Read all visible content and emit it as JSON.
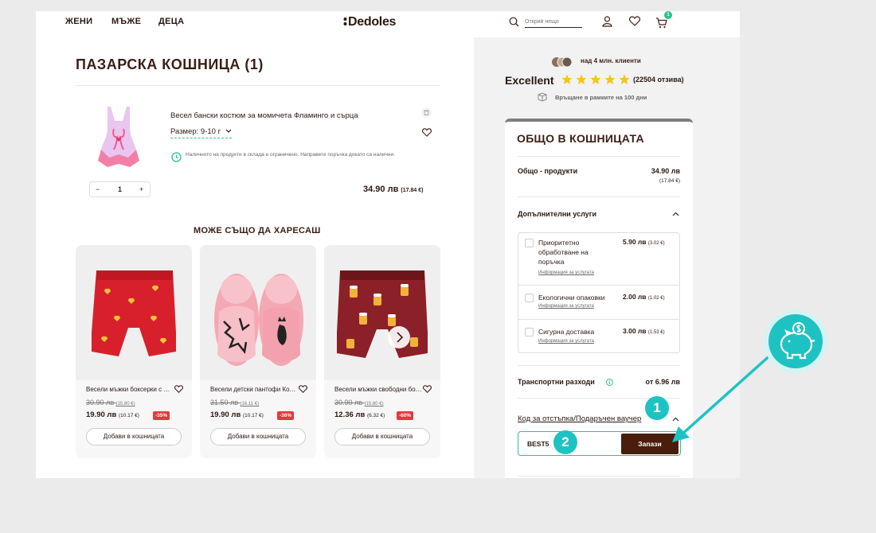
{
  "header": {
    "nav": [
      "ЖЕНИ",
      "МЪЖЕ",
      "ДЕЦА"
    ],
    "logo": "Dedoles",
    "search_placeholder": "Открий нещо",
    "cart_count": "1"
  },
  "cart": {
    "title": "ПАЗАРСКА КОШНИЦА (1)",
    "item": {
      "name": "Весел бански костюм за момичета Фламинго и сърца",
      "size": "Размер: 9-10 г",
      "stock_note": "Наличното на продукти в склада е ограничено. Направете поръчка докато са налични.",
      "qty_minus": "−",
      "qty": "1",
      "qty_plus": "+",
      "price": "34.90 лв",
      "price_eur": "(17.84 €)"
    }
  },
  "recommend": {
    "title": "МОЖЕ СЪЩО ДА ХАРЕСАШ",
    "add_label": "Добави в кошницата",
    "products": [
      {
        "name": "Весели мъжки боксерки с Valentine",
        "old": "30.90 лв",
        "old_eur": "(15.80 €)",
        "new": "19.90 лв",
        "new_eur": "(10.17 €)",
        "discount": "-35%"
      },
      {
        "name": "Весели детски пантофи Котки",
        "old": "31.50 лв",
        "old_eur": "(16.11 €)",
        "new": "19.90 лв",
        "new_eur": "(10.17 €)",
        "discount": "-36%"
      },
      {
        "name": "Весели мъжки свободни боксерки Бира",
        "old": "30.90 лв",
        "old_eur": "(15.80 €)",
        "new": "12.36 лв",
        "new_eur": "(6.32 €)",
        "discount": "-60%"
      }
    ]
  },
  "trust": {
    "clients": "над 4 млн. клиенти",
    "rating_word": "Excellent",
    "rating": 5,
    "reviews": "(22504 отзива)",
    "returns": "Връщане в рамките на 100 дни"
  },
  "summary": {
    "title": "ОБЩО В КОШНИЦАТА",
    "products_label": "Общо - продукти",
    "products_value": "34.90 лв",
    "products_eur": "(17.84 €)",
    "services_label": "Допълнителни услуги",
    "info_link": "Информация за услугата",
    "services": [
      {
        "label": "Приоритетно обработване на поръчка",
        "price": "5.90 лв",
        "eur": "(3.02 €)"
      },
      {
        "label": "Екологични опаковки",
        "price": "2.00 лв",
        "eur": "(1.02 €)"
      },
      {
        "label": "Сигурна доставка",
        "price": "3.00 лв",
        "eur": "(1.53 €)"
      }
    ],
    "shipping_label": "Транспортни разходи",
    "shipping_value": "от 6.96 лв",
    "voucher_label": "Код за отстъпка/Подаръчен ваучер",
    "voucher_value": "BEST5",
    "save_label": "Запази"
  },
  "annotations": {
    "step1": "1",
    "step2": "2"
  },
  "colors": {
    "accent": "#1fc2c2",
    "brand": "#4a1d0c",
    "discount": "#e23a3a",
    "green": "#2cc28a"
  }
}
